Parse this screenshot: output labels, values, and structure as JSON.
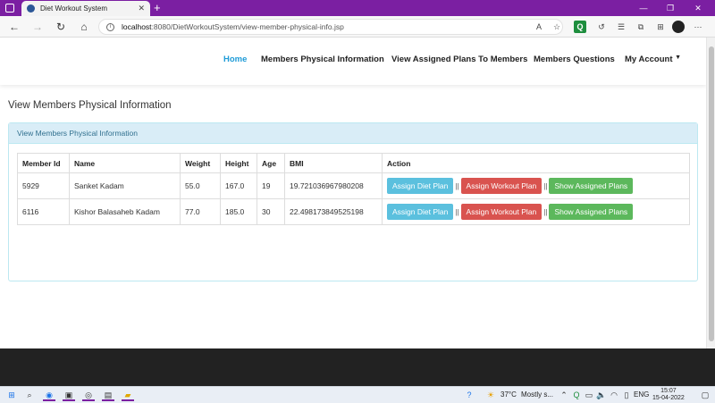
{
  "browser": {
    "tab_title": "Diet Workout System",
    "tab_close": "✕",
    "new_tab": "+",
    "url_host": "localhost",
    "url_path": ":8080/DietWorkoutSystem/view-member-physical-info.jsp",
    "min": "—",
    "max": "❐",
    "close": "✕"
  },
  "navbar": {
    "items": [
      {
        "label": "Home",
        "active": true
      },
      {
        "label": "Members Physical Information"
      },
      {
        "label": "View Assigned Plans To Members"
      },
      {
        "label": "Members Questions"
      },
      {
        "label": "My Account"
      }
    ]
  },
  "page": {
    "title": "View Members Physical Information",
    "panel_heading": "View Members Physical Information"
  },
  "table": {
    "headers": [
      "Member Id",
      "Name",
      "Weight",
      "Height",
      "Age",
      "BMI",
      "Action"
    ],
    "rows": [
      {
        "id": "5929",
        "name": "Sanket Kadam",
        "weight": "55.0",
        "height": "167.0",
        "age": "19",
        "bmi": "19.721036967980208"
      },
      {
        "id": "6116",
        "name": "Kishor Balasaheb Kadam",
        "weight": "77.0",
        "height": "185.0",
        "age": "30",
        "bmi": "22.498173849525198"
      }
    ],
    "actions": {
      "assign_diet": "Assign Diet Plan",
      "assign_workout": "Assign Workout Plan",
      "show_assigned": "Show Assigned Plans",
      "separator": "||"
    }
  },
  "taskbar": {
    "weather": "37°C",
    "weather_desc": "Mostly s...",
    "lang": "ENG",
    "time": "15:07",
    "date": "15-04-2022"
  },
  "colors": {
    "accent": "#7b1fa2",
    "nav_active": "#1e9bd7",
    "panel_heading_bg": "#d9edf7",
    "btn_info": "#5bc0de",
    "btn_danger": "#d9534f",
    "btn_success": "#5cb85c",
    "footer": "#222222"
  }
}
